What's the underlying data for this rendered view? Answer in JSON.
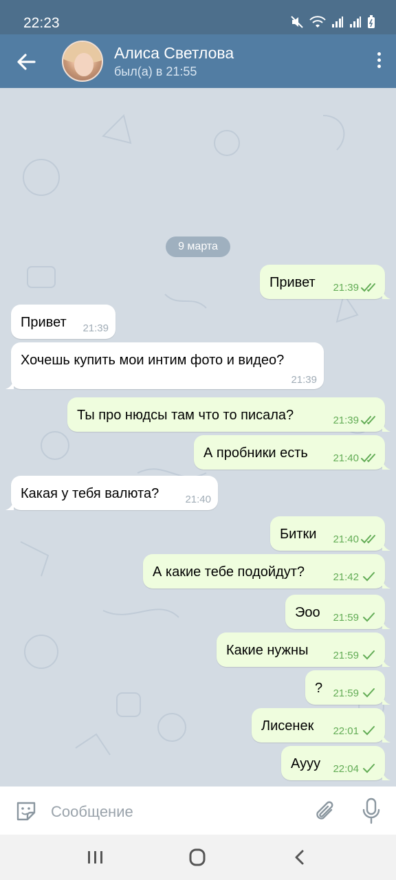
{
  "status_bar": {
    "time": "22:23"
  },
  "header": {
    "contact_name": "Алиса Светлова",
    "contact_status": "был(а) в 21:55"
  },
  "chat": {
    "date_label": "9 марта",
    "messages": [
      {
        "dir": "out",
        "text": "Привет",
        "time": "21:39",
        "read": true
      },
      {
        "dir": "in",
        "text": "Привет",
        "time": "21:39"
      },
      {
        "dir": "in",
        "text": "Хочешь купить мои интим фото и видео?",
        "time": "21:39"
      },
      {
        "dir": "out",
        "text": "Ты про нюдсы там что то писала?",
        "time": "21:39",
        "read": true
      },
      {
        "dir": "out",
        "text": "А пробники есть",
        "time": "21:40",
        "read": true
      },
      {
        "dir": "in",
        "text": "Какая у тебя валюта?",
        "time": "21:40"
      },
      {
        "dir": "out",
        "text": "Битки",
        "time": "21:40",
        "read": true
      },
      {
        "dir": "out",
        "text": "А какие тебе подойдут?",
        "time": "21:42",
        "read": false
      },
      {
        "dir": "out",
        "text": "Эоо",
        "time": "21:59",
        "read": false
      },
      {
        "dir": "out",
        "text": "Какие нужны",
        "time": "21:59",
        "read": false
      },
      {
        "dir": "out",
        "text": "?",
        "time": "21:59",
        "read": false
      },
      {
        "dir": "out",
        "text": "Лисенек",
        "time": "22:01",
        "read": false
      },
      {
        "dir": "out",
        "text": "Аууу",
        "time": "22:04",
        "read": false
      }
    ]
  },
  "composer": {
    "placeholder": "Сообщение"
  },
  "colors": {
    "header": "#527da3",
    "status_bar": "#4d6f8c",
    "outgoing_bubble": "#effdde",
    "incoming_bubble": "#ffffff",
    "check": "#62ac55",
    "chat_bg": "#d3dbe3"
  },
  "icons": {
    "back": "arrow-left-icon",
    "menu": "more-vert-icon",
    "sticker": "sticker-icon",
    "attach": "paperclip-icon",
    "mic": "microphone-icon"
  }
}
